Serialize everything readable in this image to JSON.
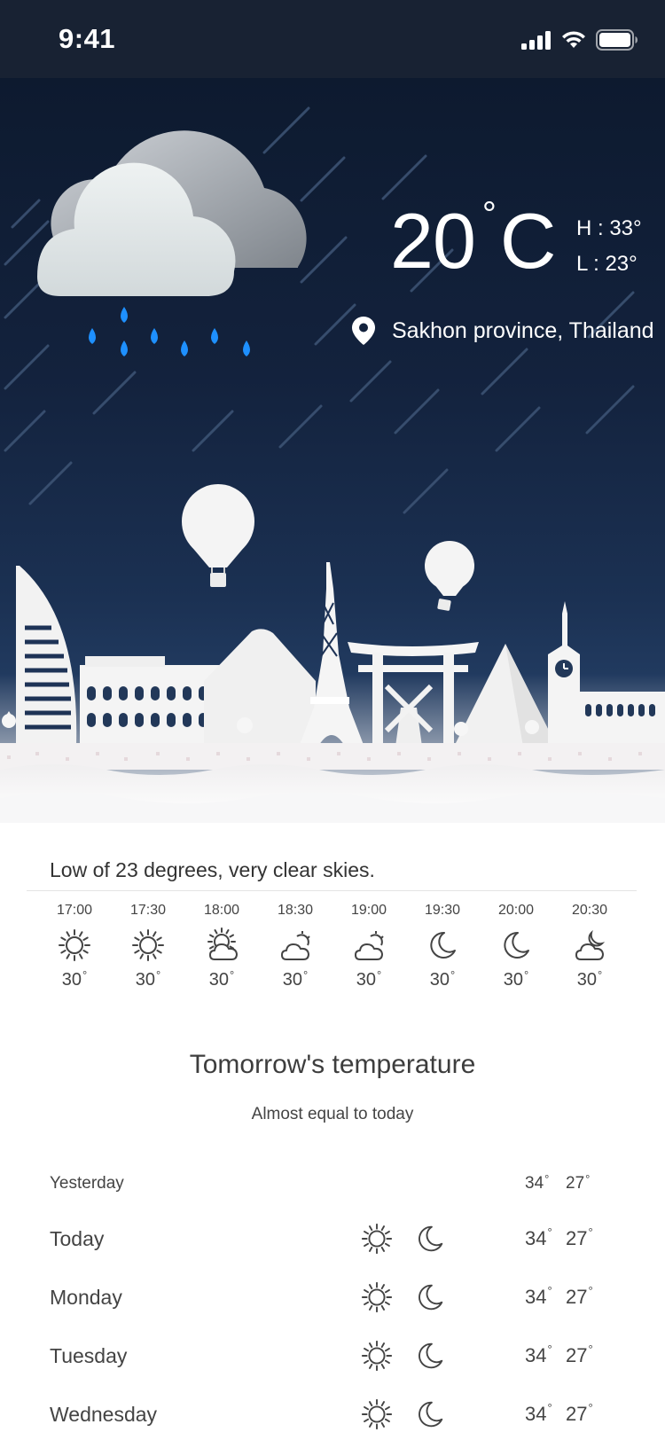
{
  "status_bar": {
    "time": "9:41",
    "icons": [
      "cellular-signal-icon",
      "wifi-icon",
      "battery-icon"
    ]
  },
  "current": {
    "temperature": "20",
    "degree_symbol": "°",
    "unit": "C",
    "high": "H : 33°",
    "low": "L : 23°",
    "location": "Sakhon province, Thailand",
    "condition_icon": "rain-cloud-icon",
    "illustration": "paper-cut-skyline-with-hot-air-balloons"
  },
  "summary": "Low of 23 degrees, very clear skies.",
  "hourly": [
    {
      "time": "17:00",
      "icon": "sun-icon",
      "temp": "30"
    },
    {
      "time": "17:30",
      "icon": "sun-icon",
      "temp": "30"
    },
    {
      "time": "18:00",
      "icon": "sun-cloud-icon",
      "temp": "30"
    },
    {
      "time": "18:30",
      "icon": "cloud-sun-icon",
      "temp": "30"
    },
    {
      "time": "19:00",
      "icon": "cloud-sun-icon",
      "temp": "30"
    },
    {
      "time": "19:30",
      "icon": "moon-icon",
      "temp": "30"
    },
    {
      "time": "20:00",
      "icon": "moon-icon",
      "temp": "30"
    },
    {
      "time": "20:30",
      "icon": "cloud-moon-icon",
      "temp": "30"
    }
  ],
  "tomorrow": {
    "title": "Tomorrow's temperature",
    "subtitle": "Almost equal to today"
  },
  "daily": [
    {
      "day": "Yesterday",
      "high": "34",
      "low": "27",
      "icons": []
    },
    {
      "day": "Today",
      "high": "34",
      "low": "27",
      "icons": [
        "sun-icon",
        "moon-icon"
      ]
    },
    {
      "day": "Monday",
      "high": "34",
      "low": "27",
      "icons": [
        "sun-icon",
        "moon-icon"
      ]
    },
    {
      "day": "Tuesday",
      "high": "34",
      "low": "27",
      "icons": [
        "sun-icon",
        "moon-icon"
      ]
    },
    {
      "day": "Wednesday",
      "high": "34",
      "low": "27",
      "icons": [
        "sun-icon",
        "moon-icon"
      ]
    }
  ],
  "colors": {
    "sky_top": "#0d1a2f",
    "sky_bottom": "#213a5f",
    "raindrop": "#1e90ff",
    "text_dark": "#3a3a3a"
  }
}
